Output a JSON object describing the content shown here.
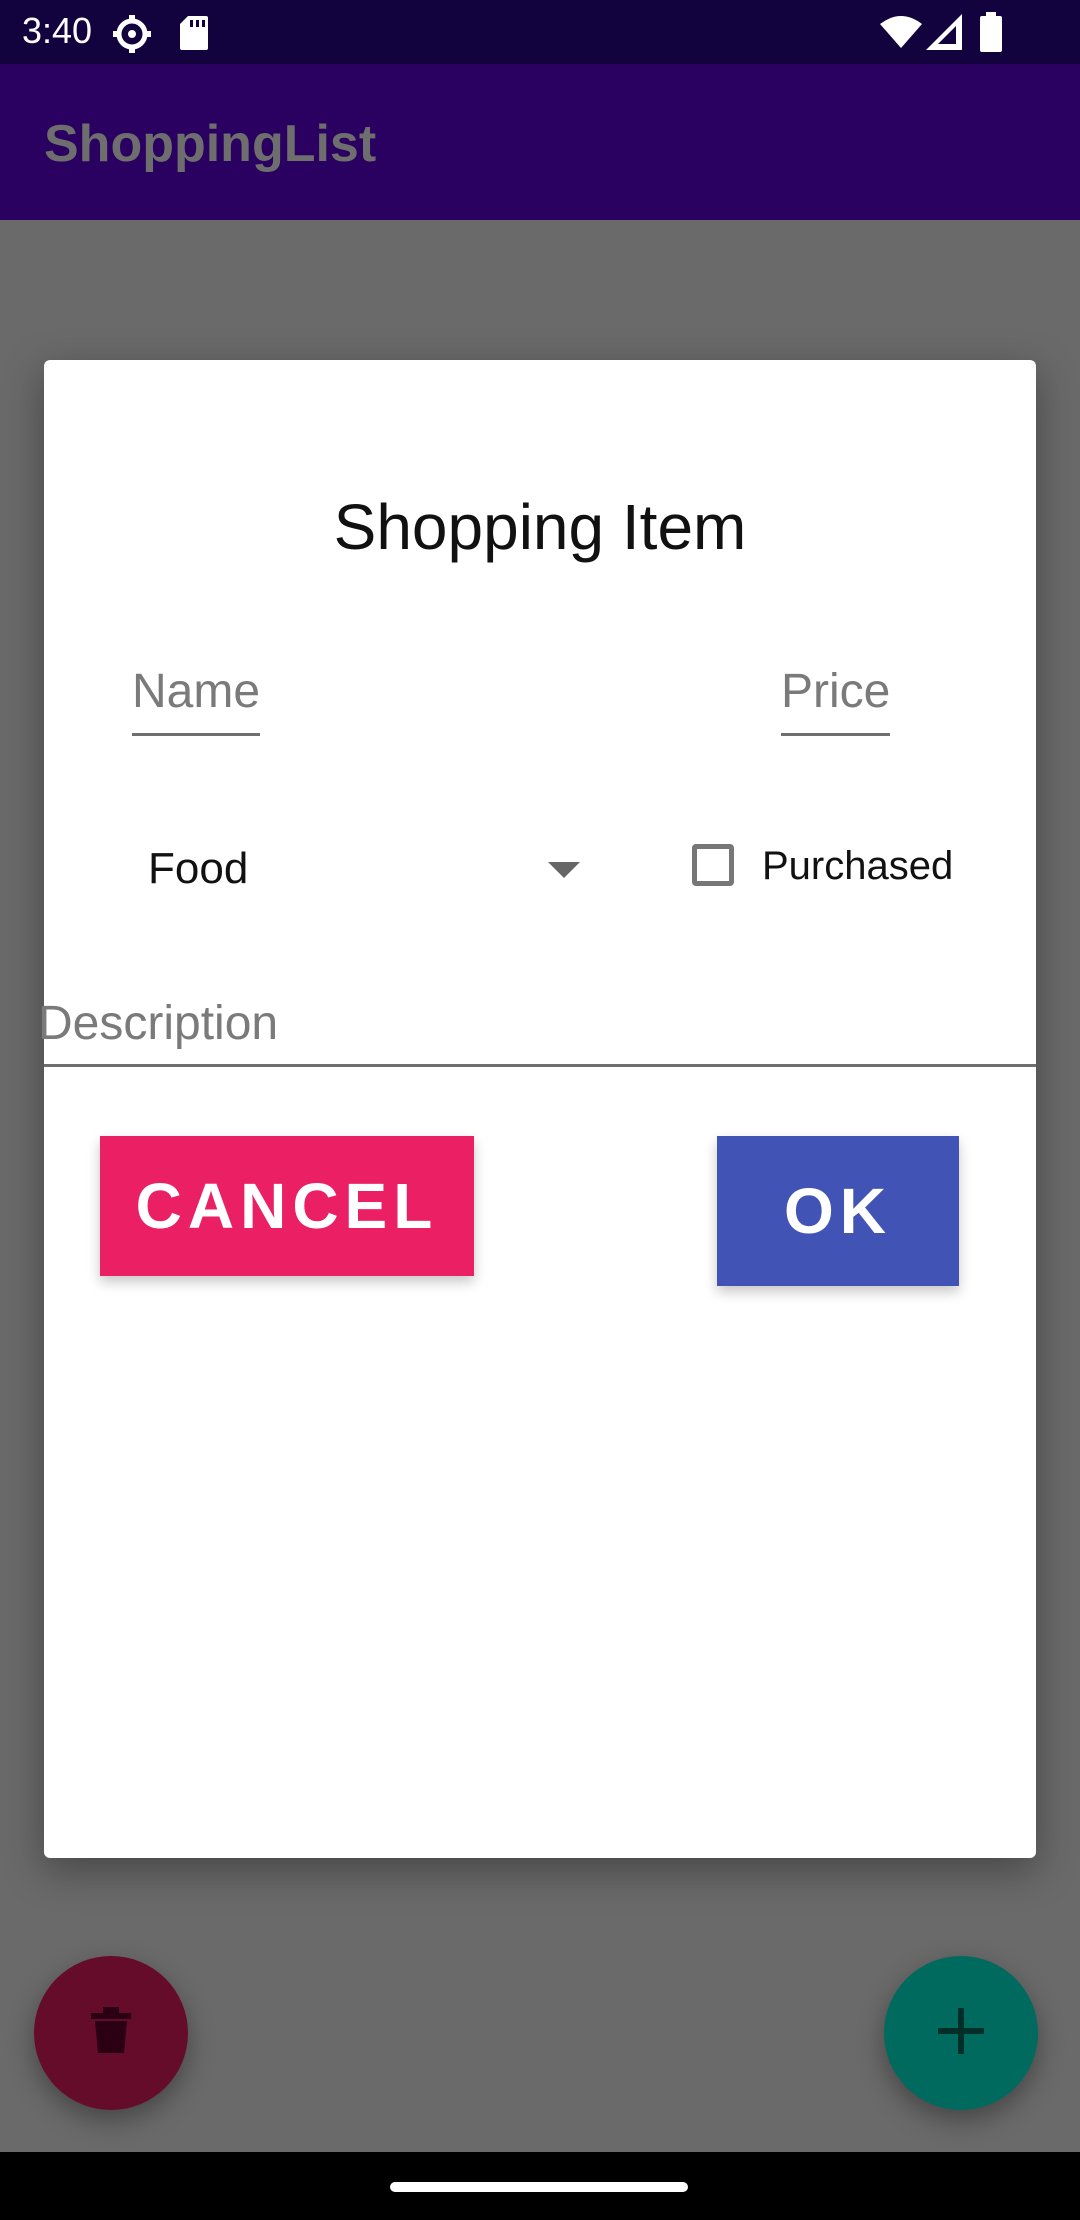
{
  "status_bar": {
    "time": "3:40",
    "icons": [
      "settings-gear-icon",
      "sd-card-icon",
      "wifi-icon",
      "signal-icon",
      "battery-icon"
    ]
  },
  "app_bar": {
    "title": "ShoppingList"
  },
  "dialog": {
    "title": "Shopping Item",
    "name_field": {
      "placeholder": "Name",
      "value": ""
    },
    "price_field": {
      "placeholder": "Price",
      "value": ""
    },
    "category_spinner": {
      "selected": "Food"
    },
    "purchased_checkbox": {
      "label": "Purchased",
      "checked": false
    },
    "description_field": {
      "placeholder": "Description",
      "value": ""
    },
    "cancel_label": "CANCEL",
    "ok_label": "OK"
  },
  "fabs": [
    {
      "name": "delete-fab",
      "icon": "trash-icon",
      "color": "#640c29"
    },
    {
      "name": "add-fab",
      "icon": "plus-icon",
      "color": "#006a5f"
    }
  ],
  "colors": {
    "status_bar": "#12033f",
    "app_bar": "#2a0060",
    "cancel": "#eb1f63",
    "ok": "#4154b6"
  }
}
